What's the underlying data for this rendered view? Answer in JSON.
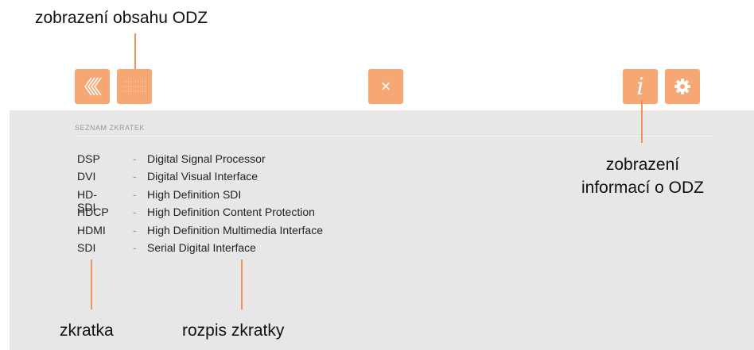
{
  "annotations": {
    "content_view": "zobrazení obsahu ODZ",
    "info_view_line1": "zobrazení",
    "info_view_line2": "informací o ODZ",
    "abbreviation": "zkratka",
    "abbreviation_expansion": "rozpis zkratky"
  },
  "toolbar": {
    "close_label": "×",
    "info_label": "i",
    "icons": [
      "double-chevron-left-icon",
      "list-icon",
      "close-icon",
      "info-icon",
      "gear-icon"
    ]
  },
  "colors": {
    "accent": "#f7a774",
    "leader_line": "#f0925f",
    "panel_background": "#e7e7e7"
  },
  "panel": {
    "heading": "SEZNAM ZKRATEK",
    "items": [
      {
        "abbr": "DSP",
        "dash": "-",
        "desc": "Digital Signal Processor"
      },
      {
        "abbr": "DVI",
        "dash": "-",
        "desc": "Digital Visual Interface"
      },
      {
        "abbr": "HD-SDI",
        "dash": "-",
        "desc": "High Definition SDI"
      },
      {
        "abbr": "HDCP",
        "dash": "-",
        "desc": "High Definition Content Protection"
      },
      {
        "abbr": "HDMI",
        "dash": "-",
        "desc": "High Definition Multimedia Interface"
      },
      {
        "abbr": "SDI",
        "dash": "-",
        "desc": "Serial Digital Interface"
      }
    ]
  }
}
